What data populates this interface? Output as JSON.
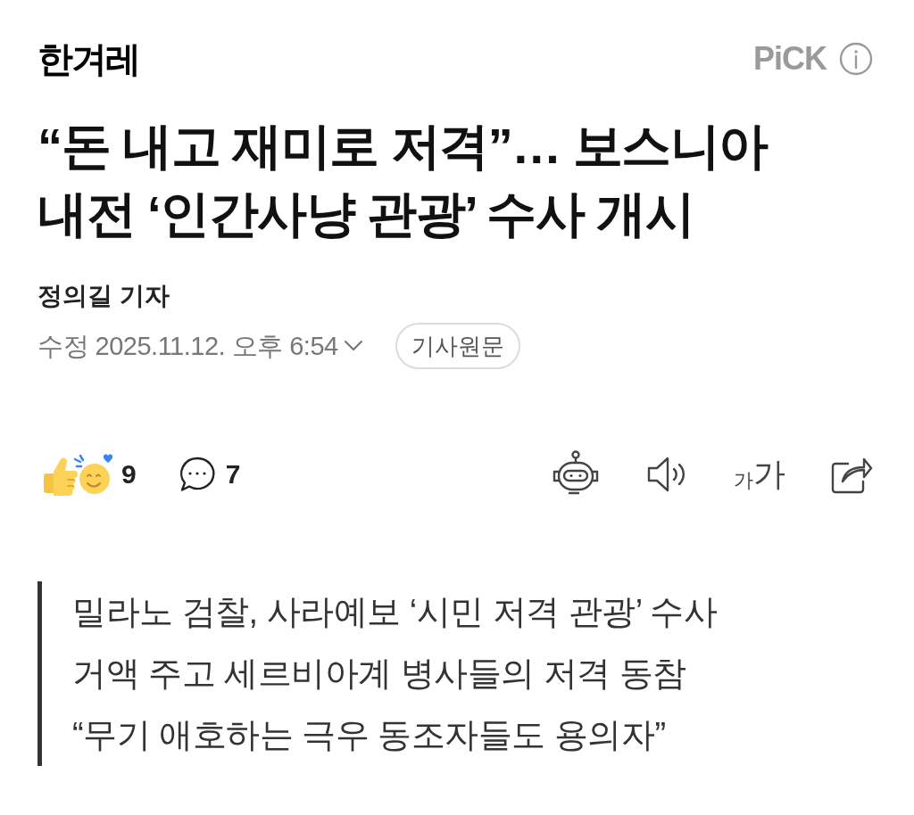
{
  "header": {
    "logo": "한겨레",
    "pick_label": "PiCK"
  },
  "article": {
    "title": "“돈 내고 재미로 저격”… 보스니아 내전 ‘인간사냥 관광’ 수사 개시",
    "byline": "정의길 기자",
    "timestamp": "수정 2025.11.12. 오후 6:54",
    "original_link": "기사원문"
  },
  "actions": {
    "reactions": "9",
    "comments": "7",
    "font_size": {
      "small": "가",
      "large": "가"
    }
  },
  "summary": [
    "밀라노 검찰, 사라예보 ‘시민 저격 관광’ 수사",
    "거액 주고 세르비아계 병사들의 저격 동참",
    "“무기 애호하는 극우 동조자들도 용의자”"
  ]
}
